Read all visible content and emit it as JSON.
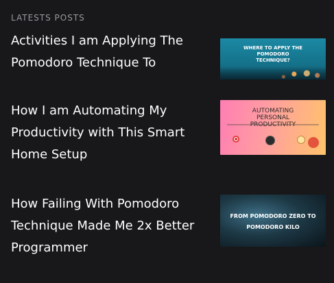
{
  "section": {
    "label": "LATESTS POSTS"
  },
  "posts": [
    {
      "title": "Activities I am Applying The Pomodoro Technique To",
      "thumbnail": {
        "caption": "WHERE TO APPLY THE POMODORO TECHNIQUE?",
        "background": "#1c89a4"
      }
    },
    {
      "title": "How I am Automating My Productivity with This Smart Home Setup",
      "thumbnail": {
        "caption": "AUTOMATING PERSONAL PRODUCTIVITY",
        "background": "#ff8fab"
      }
    },
    {
      "title": "How Failing With Pomodoro Technique Made Me 2x Better Programmer",
      "thumbnail": {
        "caption": "FROM POMODORO ZERO TO POMODORO KILO",
        "background": "#1d3946"
      }
    }
  ]
}
